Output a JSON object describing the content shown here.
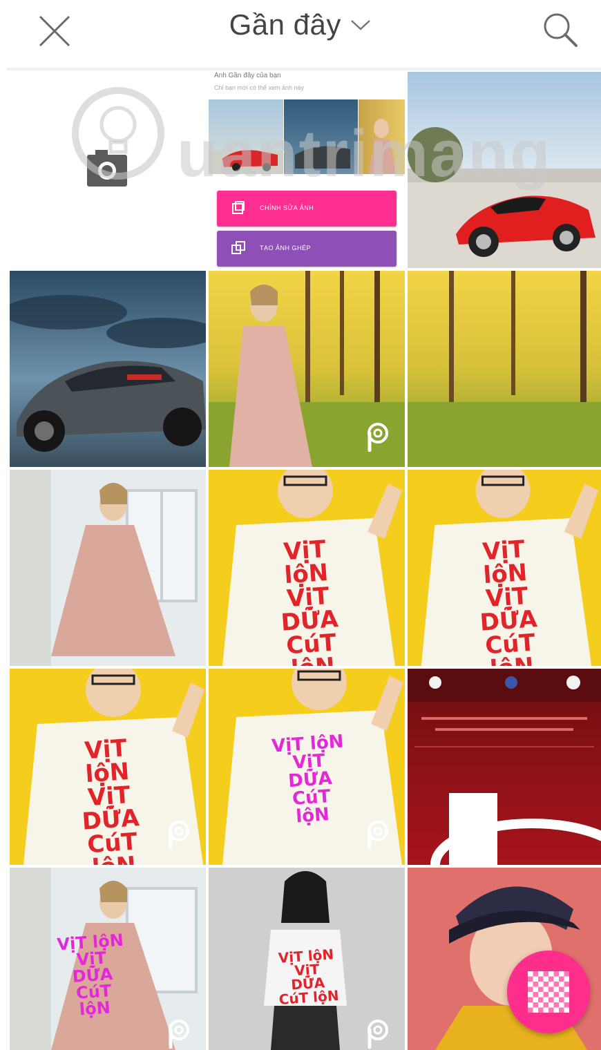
{
  "header": {
    "title": "Gần đây"
  },
  "promo": {
    "heading": "Ảnh Gần đây của bạn",
    "subheading": "Chỉ bạn mới có thể xem ảnh này",
    "edit_button": "CHỈNH SỬA ẢNH",
    "collage_button": "TẠO ẢNH GHÉP"
  },
  "shirt_text": {
    "line1": "VịT lộN",
    "line2": "VịT DỮA",
    "line3": "CúT lộN"
  },
  "watermark": {
    "text": "uantrimang"
  },
  "colors": {
    "accent_pink": "#ff2e8c",
    "promo_purple": "#8e4fb6",
    "yellow_bg": "#f5cd1d"
  },
  "icons": {
    "close": "close-icon",
    "chevron": "chevron-down-icon",
    "search": "search-icon",
    "badge": "picsart-badge-icon",
    "fab": "checker-grid-icon"
  }
}
